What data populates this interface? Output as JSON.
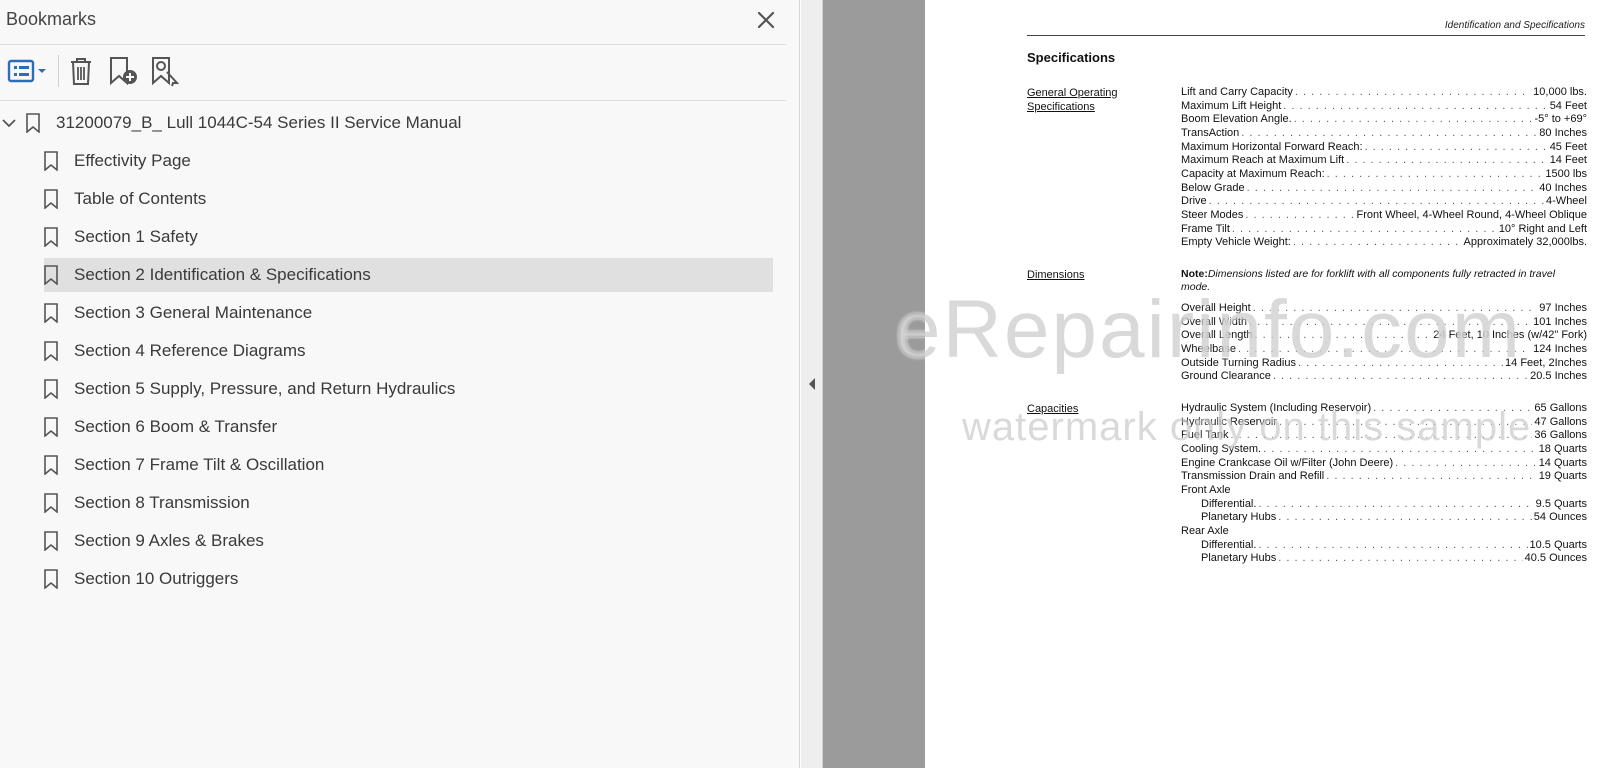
{
  "panel": {
    "title": "Bookmarks",
    "toolbar": {
      "options_icon": "list-options-icon",
      "delete_icon": "trash-icon",
      "new_bookmark_icon": "bookmark-add-icon",
      "find_bookmark_icon": "bookmark-search-icon"
    },
    "root": {
      "label": "31200079_B_ Lull 1044C-54 Series II Service Manual",
      "expanded": true
    },
    "items": [
      {
        "label": "Effectivity Page"
      },
      {
        "label": "Table of Contents"
      },
      {
        "label": "Section 1 Safety"
      },
      {
        "label": "Section 2 Identification & Specifications",
        "selected": true
      },
      {
        "label": "Section 3 General Maintenance"
      },
      {
        "label": "Section 4 Reference Diagrams"
      },
      {
        "label": "Section 5 Supply, Pressure, and Return Hydraulics"
      },
      {
        "label": "Section 6 Boom & Transfer"
      },
      {
        "label": "Section 7 Frame Tilt & Oscillation"
      },
      {
        "label": "Section 8 Transmission"
      },
      {
        "label": "Section 9 Axles & Brakes"
      },
      {
        "label": "Section 10 Outriggers"
      }
    ]
  },
  "document": {
    "running_head": "Identification and Specifications",
    "title": "Specifications",
    "general": {
      "label_line1": "General Operating",
      "label_line2": "Specifications",
      "rows": [
        {
          "name": "Lift and Carry Capacity",
          "value": "10,000 lbs."
        },
        {
          "name": "Maximum Lift Height",
          "value": "54 Feet"
        },
        {
          "name": "Boom Elevation Angle.",
          "value": "-5° to +69°"
        },
        {
          "name": "TransAction",
          "value": "80 Inches"
        },
        {
          "name": "Maximum Horizontal Forward Reach:",
          "value": "45 Feet"
        },
        {
          "name": "Maximum Reach at Maximum Lift",
          "value": "14 Feet"
        },
        {
          "name": "Capacity at Maximum Reach:",
          "value": "1500 lbs"
        },
        {
          "name": "Below Grade",
          "value": "40 Inches"
        },
        {
          "name": "Drive",
          "value": "4-Wheel"
        },
        {
          "name": "Steer Modes",
          "value": "Front Wheel, 4-Wheel Round, 4-Wheel Oblique"
        },
        {
          "name": "Frame Tilt",
          "value": "10° Right and Left"
        },
        {
          "name": "Empty Vehicle Weight:",
          "value": "Approximately 32,000lbs."
        }
      ]
    },
    "dimensions": {
      "label": "Dimensions",
      "note_prefix": "Note:",
      "note_text": "Dimensions listed are for forklift with all components fully retracted in travel mode.",
      "rows": [
        {
          "name": "Overall Height",
          "value": "97 Inches"
        },
        {
          "name": "Overall Width",
          "value": "101 Inches"
        },
        {
          "name": "Overall Length",
          "value": "24 Feet, 10 Inches (w/42\" Fork)"
        },
        {
          "name": "Wheelbase",
          "value": "124 Inches"
        },
        {
          "name": "Outside Turning Radius",
          "value": "14 Feet, 2Inches"
        },
        {
          "name": "Ground Clearance",
          "value": "20.5 Inches"
        }
      ]
    },
    "capacities": {
      "label": "Capacities",
      "rows": [
        {
          "name": "Hydraulic System (Including Reservoir)",
          "value": "65 Gallons"
        },
        {
          "name": "Hydraulic Reservoir",
          "value": "47 Gallons"
        },
        {
          "name": "Fuel Tank",
          "value": "36 Gallons"
        },
        {
          "name": "Cooling System.",
          "value": "18 Quarts"
        },
        {
          "name": "Engine Crankcase Oil w/Filter (John Deere)",
          "value": "14 Quarts"
        },
        {
          "name": "Transmission Drain and Refill",
          "value": "19 Quarts"
        }
      ],
      "front_axle": {
        "label": "Front Axle",
        "rows": [
          {
            "name": "Differential.",
            "value": "9.5 Quarts"
          },
          {
            "name": "Planetary Hubs",
            "value": "54 Ounces"
          }
        ]
      },
      "rear_axle": {
        "label": "Rear Axle",
        "rows": [
          {
            "name": "Differential.",
            "value": "10.5 Quarts"
          },
          {
            "name": "Planetary Hubs",
            "value": "40.5 Ounces"
          }
        ]
      }
    },
    "watermark_line1": "eRepairinfo.com",
    "watermark_line2": "watermark only on this sample"
  }
}
